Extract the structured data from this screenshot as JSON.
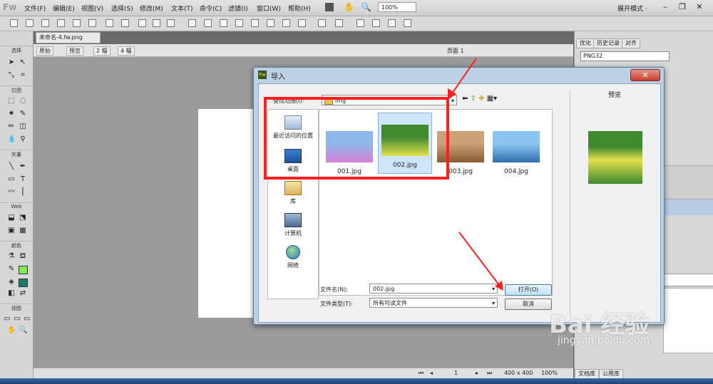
{
  "app": {
    "logo": "Fw",
    "mode": "展开模式 ·"
  },
  "menu": [
    "文件(F)",
    "编辑(E)",
    "视图(V)",
    "选择(S)",
    "修改(M)",
    "文本(T)",
    "命令(C)",
    "滤镜(I)",
    "窗口(W)",
    "帮助(H)"
  ],
  "zoom": "100%",
  "document": {
    "tab": "未命名-4.fw.png",
    "views": [
      "原始",
      "预览",
      "2 幅",
      "4 幅"
    ],
    "page": "页面 1",
    "status": {
      "page_number": "1",
      "size": "400 x 400",
      "zoom": "100%"
    }
  },
  "tools": {
    "sections": [
      "选择",
      "位图",
      "矢量",
      "Web",
      "颜色",
      "视图"
    ],
    "stroke_color": "#7cf04a",
    "fill_color": "#1b7c6a"
  },
  "right_panel": {
    "tabs": [
      "优化",
      "历史记录",
      "对齐"
    ],
    "format": "PNG32",
    "bottom_tabs": [
      "文档库",
      "公用库"
    ]
  },
  "dialog": {
    "icon": "Fw",
    "title": "导入",
    "lookin_label": "查找范围(I):",
    "lookin_value": "img",
    "preview_label": "预览",
    "places": [
      "最近访问的位置",
      "桌面",
      "库",
      "计算机",
      "网络"
    ],
    "files": [
      {
        "name": "001.jpg",
        "selected": false,
        "colors": [
          "#8fb6e8",
          "#d77fd6"
        ]
      },
      {
        "name": "002.jpg",
        "selected": true,
        "colors": [
          "#3f8a2f",
          "#e4e04c"
        ]
      },
      {
        "name": "003.jpg",
        "selected": false,
        "colors": [
          "#c9a27a",
          "#8a5a32"
        ]
      },
      {
        "name": "004.jpg",
        "selected": false,
        "colors": [
          "#8cc6f0",
          "#2d6fb0"
        ]
      }
    ],
    "filename_label": "文件名(N):",
    "filename_value": "002.jpg",
    "filetype_label": "文件类型(T):",
    "filetype_value": "所有可读文件",
    "open_button": "打开(O)",
    "cancel_button": "取消"
  },
  "watermark": {
    "brand": "Bai 经验",
    "url": "jingyan.baidu.com"
  },
  "colors": {
    "annotation_red": "#ff1f1f",
    "selection": "#cde6fb"
  }
}
